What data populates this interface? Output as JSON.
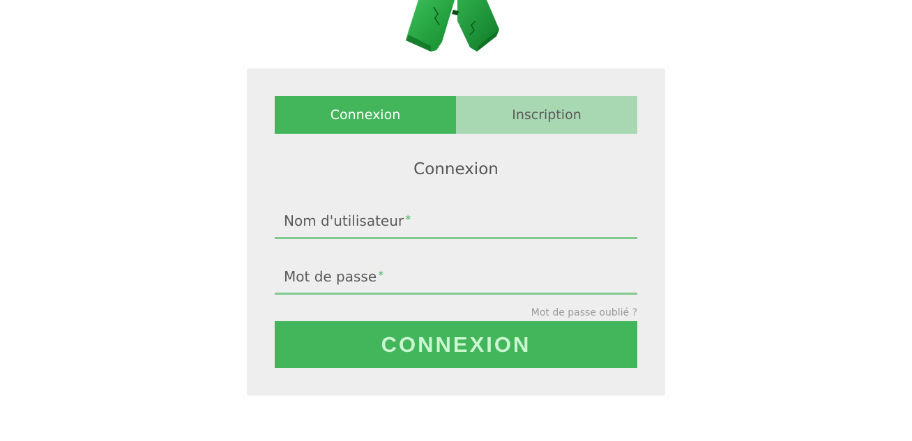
{
  "tabs": [
    {
      "label": "Connexion",
      "active": true
    },
    {
      "label": "Inscription",
      "active": false
    }
  ],
  "form": {
    "title": "Connexion",
    "username_label": "Nom d'utilisateur",
    "password_label": "Mot de passe",
    "required_mark": "*",
    "forgot_password": "Mot de passe oublié ?",
    "submit_label": "CONNEXION"
  },
  "colors": {
    "accent": "#43b55b",
    "tab_inactive": "#a8d8b2",
    "card_bg": "#eeeeee",
    "field_underline": "#80c98e",
    "button_text": "#c9f7cf"
  },
  "icons": {
    "logo": "green-cracked-block-logo"
  }
}
